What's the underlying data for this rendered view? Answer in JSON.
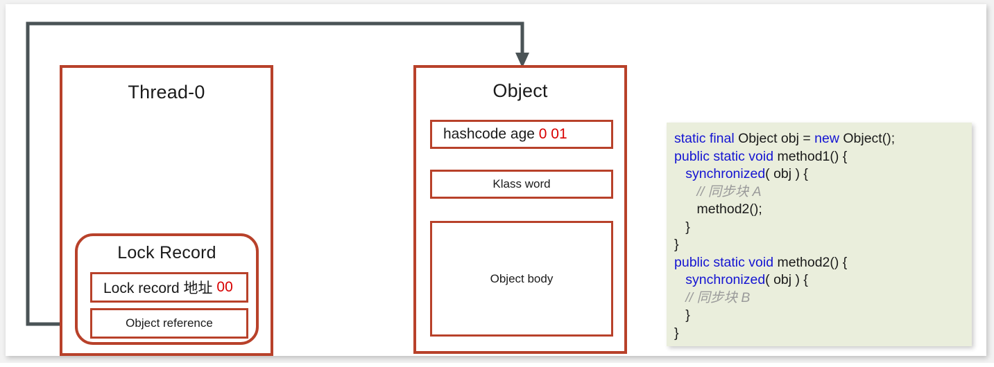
{
  "diagram": {
    "thread": {
      "title": "Thread-0",
      "lock_record": {
        "title": "Lock Record",
        "address_label": "Lock record 地址",
        "address_bits": "00",
        "object_reference_label": "Object reference"
      }
    },
    "object": {
      "title": "Object",
      "mark_word": {
        "label": "hashcode age",
        "bits": "0 01"
      },
      "klass_word_label": "Klass word",
      "object_body_label": "Object body"
    },
    "connector": {
      "from": "Object reference",
      "to": "Object",
      "arrow_name": "object-reference-arrow"
    }
  },
  "code": {
    "lines": [
      [
        {
          "t": "static final ",
          "s": "kw"
        },
        {
          "t": "Object obj = ",
          "s": "plain"
        },
        {
          "t": "new ",
          "s": "kw"
        },
        {
          "t": "Object();",
          "s": "plain"
        }
      ],
      [
        {
          "t": "public static void ",
          "s": "kw"
        },
        {
          "t": "method1() {",
          "s": "plain"
        }
      ],
      [
        {
          "t": "   ",
          "s": "plain"
        },
        {
          "t": "synchronized",
          "s": "kw"
        },
        {
          "t": "( obj ) {",
          "s": "plain"
        }
      ],
      [
        {
          "t": "      // 同步块 A",
          "s": "cmt"
        }
      ],
      [
        {
          "t": "      method2();",
          "s": "plain"
        }
      ],
      [
        {
          "t": "   }",
          "s": "plain"
        }
      ],
      [
        {
          "t": "}",
          "s": "plain"
        }
      ],
      [
        {
          "t": "public static void ",
          "s": "kw"
        },
        {
          "t": "method2() {",
          "s": "plain"
        }
      ],
      [
        {
          "t": "   ",
          "s": "plain"
        },
        {
          "t": "synchronized",
          "s": "kw"
        },
        {
          "t": "( obj ) {",
          "s": "plain"
        }
      ],
      [
        {
          "t": "   // 同步块 B",
          "s": "cmt"
        }
      ],
      [
        {
          "t": "   }",
          "s": "plain"
        }
      ],
      [
        {
          "t": "}",
          "s": "plain"
        }
      ]
    ]
  },
  "colors": {
    "box_border": "#B8412A",
    "accent_red": "#D80000",
    "keyword_blue": "#1414D2",
    "comment_gray": "#9a9a9a",
    "connector_gray": "#4A5356",
    "code_background": "#EAEEDC"
  }
}
